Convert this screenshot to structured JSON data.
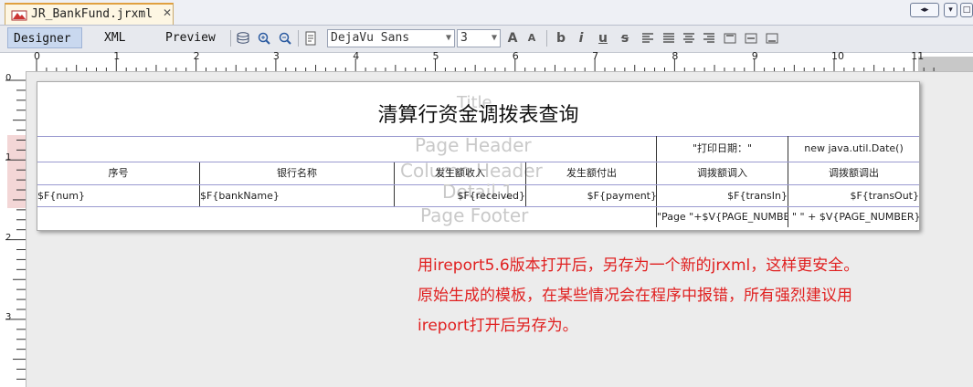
{
  "tab": {
    "title": "JR_BankFund.jrxml",
    "close": "✕"
  },
  "window_buttons": [
    "◂▸",
    "▾",
    "□"
  ],
  "view_tabs": {
    "designer": "Designer",
    "xml": "XML",
    "preview": "Preview"
  },
  "font": {
    "family": "DejaVu Sans",
    "size": "3"
  },
  "format_buttons": {
    "grow": "A",
    "shrink": "A",
    "bold": "b",
    "italic": "i",
    "underline": "u",
    "strike": "s"
  },
  "ruler": {
    "labels": [
      "0",
      "1",
      "2",
      "3",
      "4",
      "5",
      "6",
      "7",
      "8",
      "9",
      "10",
      "11"
    ]
  },
  "report": {
    "title": "清算行资金调拨表查询",
    "band_labels": {
      "title": "Title",
      "page_header": "Page Header",
      "column_header": "Column Header",
      "detail": "Detail 1",
      "page_footer": "Page Footer"
    },
    "page_header": {
      "print_date_label": "\"打印日期：\"",
      "print_date_expr": "new java.util.Date()"
    },
    "columns": [
      "序号",
      "银行名称",
      "发生额收入",
      "发生额付出",
      "调拨额调入",
      "调拨额调出"
    ],
    "fields": [
      "$F{num}",
      "$F{bankName}",
      "$F{received}",
      "$F{payment}",
      "$F{transIn}",
      "$F{transOut}"
    ],
    "footer": {
      "page_expr": "\"Page \"+$V{PAGE_NUMBER}+\"",
      "total_expr": "\" \" + $V{PAGE_NUMBER}"
    }
  },
  "note": {
    "line1": "用ireport5.6版本打开后，另存为一个新的jrxml，这样更安全。",
    "line2": "原始生成的模板，在某些情况会在程序中报错，所有强烈建议用",
    "line3": "ireport打开后另存为。"
  }
}
